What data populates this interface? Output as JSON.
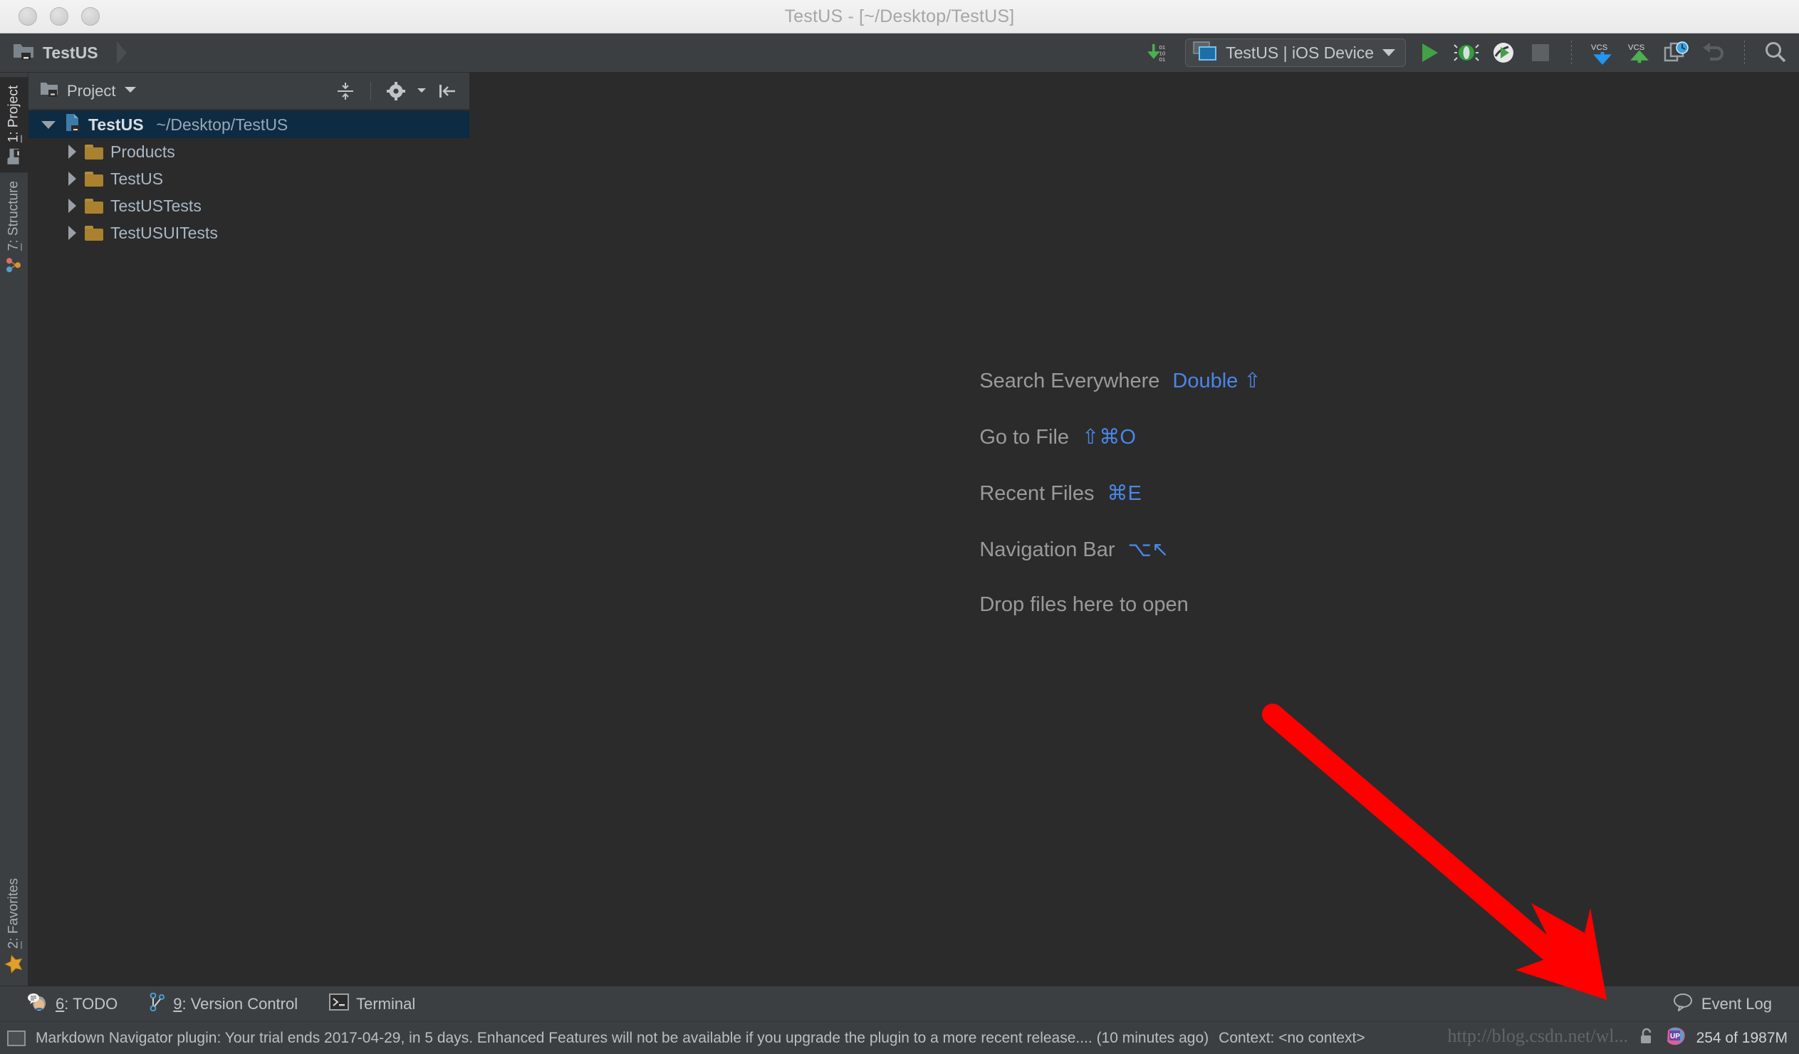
{
  "window": {
    "title": "TestUS - [~/Desktop/TestUS]",
    "traffic_lights": [
      "close",
      "minimize",
      "zoom"
    ]
  },
  "toolbar": {
    "breadcrumb": "TestUS",
    "run_config": "TestUS | iOS Device",
    "icons": [
      "vcs-update-numbers-icon",
      "run-icon",
      "debug-icon",
      "run-coverage-icon",
      "stop-icon",
      "vcs-update-icon",
      "vcs-commit-icon",
      "vcs-history-icon",
      "undo-icon",
      "search-icon"
    ]
  },
  "left_stripe": {
    "top_tabs": [
      {
        "num": "1",
        "label": ": Project",
        "icon": "project-folder-icon",
        "active": true
      },
      {
        "num": "7",
        "label": ": Structure",
        "icon": "structure-icon",
        "active": false
      }
    ],
    "bottom_tabs": [
      {
        "num": "2",
        "label": ": Favorites",
        "icon": "star-icon",
        "active": false
      }
    ]
  },
  "project_panel": {
    "title": "Project",
    "header_icons": [
      "collapse-all-icon",
      "gear-icon",
      "hide-panel-icon"
    ],
    "tree": {
      "root": {
        "name": "TestUS",
        "path": "~/Desktop/TestUS",
        "expanded": true
      },
      "children": [
        {
          "name": "Products"
        },
        {
          "name": "TestUS"
        },
        {
          "name": "TestUSTests"
        },
        {
          "name": "TestUSUITests"
        }
      ]
    }
  },
  "editor_hints": [
    {
      "label": "Search Everywhere",
      "key": "Double ⇧"
    },
    {
      "label": "Go to File",
      "key": "⇧⌘O"
    },
    {
      "label": "Recent Files",
      "key": "⌘E"
    },
    {
      "label": "Navigation Bar",
      "key": "⌥↖"
    },
    {
      "label": "Drop files here to open",
      "key": ""
    }
  ],
  "bottom_bar": {
    "tabs": [
      {
        "num": "6",
        "label": ": TODO",
        "icon": "todo-icon"
      },
      {
        "num": "9",
        "label": ": Version Control",
        "icon": "branch-icon"
      },
      {
        "num": "",
        "label": "Terminal",
        "icon": "terminal-icon"
      }
    ],
    "event_log": "Event Log"
  },
  "status_bar": {
    "message": "Markdown Navigator plugin: Your trial ends 2017-04-29, in 5 days. Enhanced Features will not be available if you upgrade the plugin to a more recent release.... (10 minutes ago)",
    "context": "Context: <no context>",
    "memory": "254 of 1987M",
    "icons": [
      "lock-icon",
      "up-badge-icon"
    ],
    "watermark": "http://blog.csdn.net/wl..."
  },
  "colors": {
    "accent_blue": "#4a86e8",
    "panel": "#3c3f41",
    "editor_bg": "#2b2b2b",
    "selection": "#0d2b42",
    "folder": "#a9812f",
    "run_green": "#50b04a",
    "annotation_red": "#fe0000"
  }
}
